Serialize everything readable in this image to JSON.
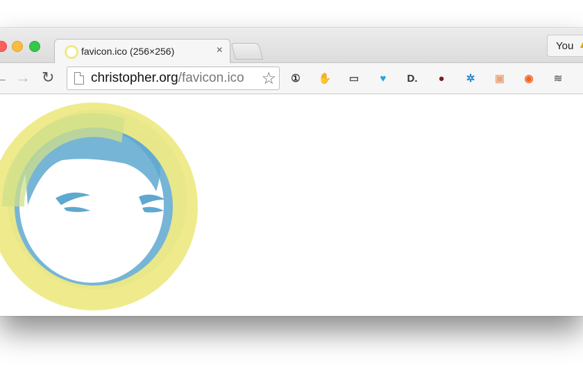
{
  "tab": {
    "title": "favicon.ico (256×256)",
    "close_glyph": "×"
  },
  "profile": {
    "label": "You",
    "warning_glyph": "▲"
  },
  "omnibox": {
    "host": "christopher.org",
    "path": "/favicon.ico"
  },
  "toolbar": {
    "back_glyph": "←",
    "forward_glyph": "→",
    "reload_glyph": "↻",
    "star_glyph": "☆",
    "extensions": [
      {
        "name": "onepassword-icon",
        "glyph": "①",
        "color": "#333333"
      },
      {
        "name": "adblock-icon",
        "glyph": "✋",
        "color": "#e53935"
      },
      {
        "name": "cast-icon",
        "glyph": "▭",
        "color": "#555555"
      },
      {
        "name": "bird-icon",
        "glyph": "♥",
        "color": "#29a3d9"
      },
      {
        "name": "d-icon",
        "glyph": "D.",
        "color": "#333333"
      },
      {
        "name": "seminole-icon",
        "glyph": "●",
        "color": "#7a1c1c"
      },
      {
        "name": "molecule-icon",
        "glyph": "✲",
        "color": "#1e88c8"
      },
      {
        "name": "face-box-icon",
        "glyph": "▣",
        "color": "#e8a67a"
      },
      {
        "name": "compass-icon",
        "glyph": "◉",
        "color": "#f26522"
      },
      {
        "name": "stack-icon",
        "glyph": "≋",
        "color": "#777777"
      },
      {
        "name": "menu-icon",
        "glyph": "≡",
        "color": "#444444"
      }
    ]
  },
  "colors": {
    "ring_yellow": "#eeea86",
    "ring_green": "#cfe08a",
    "face_blue": "#5fa8cf"
  }
}
